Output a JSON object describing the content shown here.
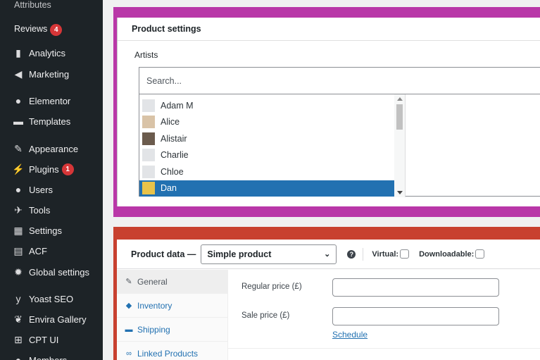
{
  "sidebar": {
    "sub_items": [
      {
        "label": "Attributes"
      },
      {
        "label": "Reviews",
        "badge": "4"
      }
    ],
    "items": [
      {
        "label": "Analytics",
        "icon": "analytics-icon",
        "glyph": "▮"
      },
      {
        "label": "Marketing",
        "icon": "megaphone-icon",
        "glyph": "◀"
      },
      {
        "label": "Elementor",
        "icon": "elementor-icon",
        "glyph": "●"
      },
      {
        "label": "Templates",
        "icon": "folder-icon",
        "glyph": "▬"
      },
      {
        "label": "Appearance",
        "icon": "paintbrush-icon",
        "glyph": "✎"
      },
      {
        "label": "Plugins",
        "icon": "plugin-icon",
        "glyph": "⚡",
        "badge": "1"
      },
      {
        "label": "Users",
        "icon": "users-icon",
        "glyph": "●"
      },
      {
        "label": "Tools",
        "icon": "wrench-icon",
        "glyph": "✈"
      },
      {
        "label": "Settings",
        "icon": "settings-icon",
        "glyph": "▦"
      },
      {
        "label": "ACF",
        "icon": "acf-icon",
        "glyph": "▤"
      },
      {
        "label": "Global settings",
        "icon": "gear-icon",
        "glyph": "✹"
      },
      {
        "label": "Yoast SEO",
        "icon": "yoast-icon",
        "glyph": "y"
      },
      {
        "label": "Envira Gallery",
        "icon": "leaf-icon",
        "glyph": "❦"
      },
      {
        "label": "CPT UI",
        "icon": "cpt-icon",
        "glyph": "⊞"
      },
      {
        "label": "Members",
        "icon": "members-icon",
        "glyph": "●"
      }
    ]
  },
  "product_settings": {
    "title": "Product settings",
    "artists_label": "Artists",
    "search_placeholder": "Search...",
    "artists": [
      {
        "name": "Adam M"
      },
      {
        "name": "Alice"
      },
      {
        "name": "Alistair"
      },
      {
        "name": "Charlie"
      },
      {
        "name": "Chloe"
      },
      {
        "name": "Dan",
        "selected": true
      }
    ]
  },
  "product_data": {
    "title": "Product data —",
    "type_value": "Simple product",
    "help": "?",
    "virtual_label": "Virtual:",
    "downloadable_label": "Downloadable:",
    "tabs": [
      {
        "label": "General",
        "icon": "wrench-icon",
        "glyph": "✎",
        "active": true
      },
      {
        "label": "Inventory",
        "icon": "tag-icon",
        "glyph": "◆"
      },
      {
        "label": "Shipping",
        "icon": "truck-icon",
        "glyph": "▬"
      },
      {
        "label": "Linked Products",
        "icon": "link-icon",
        "glyph": "∞"
      }
    ],
    "regular_price_label": "Regular price (£)",
    "sale_price_label": "Sale price (£)",
    "schedule_link": "Schedule"
  }
}
